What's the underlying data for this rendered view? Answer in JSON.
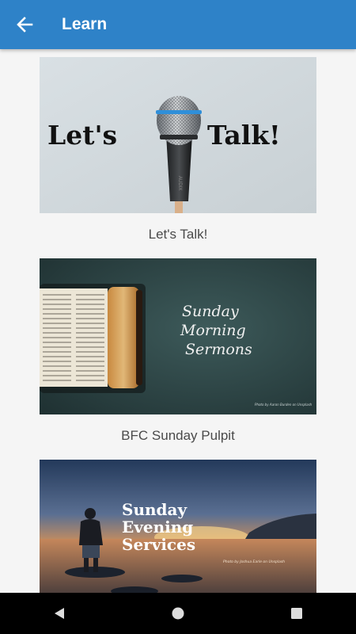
{
  "app_bar": {
    "title": "Learn",
    "back_icon": "arrow-left-icon",
    "color": "#2e82c8"
  },
  "cards": [
    {
      "caption": "Let's Talk!",
      "image": {
        "left_text": "Let's",
        "right_text": "Talk!",
        "subject": "microphone"
      }
    },
    {
      "caption": "BFC Sunday Pulpit",
      "image": {
        "lines": [
          "Sunday",
          "Morning",
          "Sermons"
        ],
        "credit": "Photo by Aaron Burden on Unsplash",
        "subject": "open-bible"
      }
    },
    {
      "caption": "",
      "image": {
        "lines": [
          "Sunday",
          "Evening",
          "Services"
        ],
        "credit": "Photo by Joshua Earle on Unsplash",
        "subject": "man-at-sunset"
      }
    }
  ],
  "nav": {
    "back_icon": "triangle-back-icon",
    "home_icon": "circle-home-icon",
    "recents_icon": "square-recents-icon"
  }
}
